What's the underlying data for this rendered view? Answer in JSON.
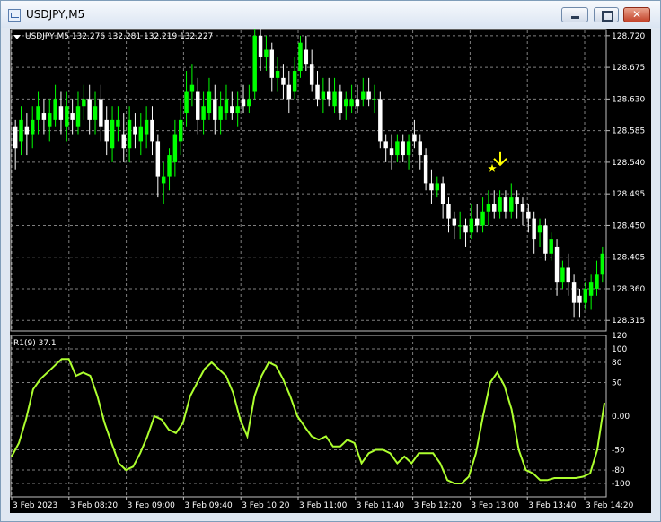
{
  "window": {
    "title": "USDJPY,M5",
    "icon": "chart-window-icon",
    "buttons": {
      "minimize": "minimize-icon",
      "maximize": "maximize-icon",
      "close": "close-icon",
      "close_glyph": "✕"
    }
  },
  "chart": {
    "symbol_line": "USDJPY,M5  132.276 132.281 132.219 132.227",
    "symbol_menu_icon": "triangle-down-icon",
    "indicator_label": "R1(9) 37.1",
    "colors": {
      "background": "#000000",
      "bull": "#00ff00",
      "bear": "#ffffff",
      "oscillator": "#adff2f",
      "grid": "#7f7f7f",
      "signal": "#ffff00"
    },
    "price_axis": [
      "128.720",
      "128.675",
      "128.630",
      "128.585",
      "128.540",
      "128.495",
      "128.450",
      "128.405",
      "128.360",
      "128.315"
    ],
    "oscillator_axis": [
      "120",
      "100",
      "80",
      "50",
      "0.00",
      "-50",
      "-80",
      "-100"
    ],
    "time_axis": [
      "3 Feb 2023",
      "3 Feb 08:20",
      "3 Feb 09:00",
      "3 Feb 09:40",
      "3 Feb 10:20",
      "3 Feb 11:00",
      "3 Feb 11:40",
      "3 Feb 12:20",
      "3 Feb 13:00",
      "3 Feb 13:40",
      "3 Feb 14:20"
    ],
    "signal_icons": [
      "sell-arrow-icon",
      "star-icon"
    ]
  },
  "chart_data": {
    "type": "candlestick",
    "price_range": [
      128.3,
      128.73
    ],
    "candles": [
      [
        128.59,
        128.56,
        128.6,
        128.53
      ],
      [
        128.57,
        128.6,
        128.62,
        128.55
      ],
      [
        128.59,
        128.58,
        128.61,
        128.55
      ],
      [
        128.58,
        128.6,
        128.62,
        128.56
      ],
      [
        128.6,
        128.62,
        128.64,
        128.58
      ],
      [
        128.61,
        128.6,
        128.63,
        128.58
      ],
      [
        128.59,
        128.61,
        128.63,
        128.57
      ],
      [
        128.6,
        128.63,
        128.65,
        128.59
      ],
      [
        128.62,
        128.6,
        128.64,
        128.58
      ],
      [
        128.59,
        128.62,
        128.64,
        128.57
      ],
      [
        128.61,
        128.6,
        128.63,
        128.58
      ],
      [
        128.59,
        128.62,
        128.64,
        128.58
      ],
      [
        128.62,
        128.63,
        128.65,
        128.6
      ],
      [
        128.63,
        128.6,
        128.65,
        128.58
      ],
      [
        128.6,
        128.62,
        128.64,
        128.58
      ],
      [
        128.63,
        128.59,
        128.65,
        128.57
      ],
      [
        128.6,
        128.57,
        128.62,
        128.55
      ],
      [
        128.56,
        128.6,
        128.62,
        128.54
      ],
      [
        128.59,
        128.6,
        128.62,
        128.57
      ],
      [
        128.58,
        128.56,
        128.61,
        128.54
      ],
      [
        128.56,
        128.6,
        128.62,
        128.54
      ],
      [
        128.59,
        128.58,
        128.61,
        128.56
      ],
      [
        128.57,
        128.59,
        128.61,
        128.55
      ],
      [
        128.58,
        128.6,
        128.62,
        128.56
      ],
      [
        128.6,
        128.57,
        128.62,
        128.55
      ],
      [
        128.57,
        128.52,
        128.58,
        128.49
      ],
      [
        128.51,
        128.52,
        128.54,
        128.48
      ],
      [
        128.52,
        128.55,
        128.56,
        128.5
      ],
      [
        128.54,
        128.58,
        128.6,
        128.52
      ],
      [
        128.57,
        128.6,
        128.63,
        128.55
      ],
      [
        128.61,
        128.64,
        128.67,
        128.59
      ],
      [
        128.64,
        128.65,
        128.68,
        128.62
      ],
      [
        128.64,
        128.6,
        128.66,
        128.58
      ],
      [
        128.6,
        128.62,
        128.64,
        128.58
      ],
      [
        128.61,
        128.64,
        128.66,
        128.6
      ],
      [
        128.63,
        128.6,
        128.65,
        128.58
      ],
      [
        128.6,
        128.62,
        128.64,
        128.58
      ],
      [
        128.61,
        128.63,
        128.65,
        128.6
      ],
      [
        128.62,
        128.61,
        128.64,
        128.6
      ],
      [
        128.61,
        128.62,
        128.64,
        128.59
      ],
      [
        128.63,
        128.62,
        128.65,
        128.61
      ],
      [
        128.62,
        128.63,
        128.65,
        128.61
      ],
      [
        128.64,
        128.72,
        128.73,
        128.63
      ],
      [
        128.72,
        128.69,
        128.73,
        128.67
      ],
      [
        128.69,
        128.7,
        128.72,
        128.67
      ],
      [
        128.7,
        128.66,
        128.71,
        128.64
      ],
      [
        128.66,
        128.67,
        128.69,
        128.64
      ],
      [
        128.66,
        128.65,
        128.68,
        128.63
      ],
      [
        128.65,
        128.63,
        128.67,
        128.61
      ],
      [
        128.64,
        128.67,
        128.69,
        128.63
      ],
      [
        128.67,
        128.71,
        128.72,
        128.66
      ],
      [
        128.7,
        128.68,
        128.72,
        128.67
      ],
      [
        128.68,
        128.65,
        128.7,
        128.64
      ],
      [
        128.65,
        128.63,
        128.67,
        128.62
      ],
      [
        128.63,
        128.64,
        128.66,
        128.61
      ],
      [
        128.64,
        128.63,
        128.66,
        128.62
      ],
      [
        128.62,
        128.64,
        128.66,
        128.61
      ],
      [
        128.64,
        128.61,
        128.65,
        128.6
      ],
      [
        128.62,
        128.63,
        128.64,
        128.6
      ],
      [
        128.62,
        128.63,
        128.65,
        128.61
      ],
      [
        128.63,
        128.62,
        128.65,
        128.61
      ],
      [
        128.63,
        128.64,
        128.66,
        128.62
      ],
      [
        128.64,
        128.63,
        128.66,
        128.62
      ],
      [
        128.63,
        128.63,
        128.65,
        128.61
      ],
      [
        128.63,
        128.57,
        128.64,
        128.56
      ],
      [
        128.57,
        128.56,
        128.58,
        128.54
      ],
      [
        128.56,
        128.55,
        128.58,
        128.53
      ],
      [
        128.55,
        128.57,
        128.58,
        128.54
      ],
      [
        128.57,
        128.55,
        128.58,
        128.54
      ],
      [
        128.55,
        128.57,
        128.58,
        128.53
      ],
      [
        128.58,
        128.57,
        128.6,
        128.56
      ],
      [
        128.57,
        128.55,
        128.58,
        128.53
      ],
      [
        128.55,
        128.51,
        128.56,
        128.5
      ],
      [
        128.51,
        128.5,
        128.53,
        128.48
      ],
      [
        128.5,
        128.51,
        128.52,
        128.49
      ],
      [
        128.51,
        128.48,
        128.52,
        128.46
      ],
      [
        128.48,
        128.46,
        128.49,
        128.44
      ],
      [
        128.46,
        128.45,
        128.47,
        128.43
      ],
      [
        128.45,
        128.45,
        128.47,
        128.43
      ],
      [
        128.45,
        128.44,
        128.46,
        128.42
      ],
      [
        128.44,
        128.46,
        128.48,
        128.43
      ],
      [
        128.46,
        128.45,
        128.48,
        128.44
      ],
      [
        128.45,
        128.47,
        128.49,
        128.44
      ],
      [
        128.47,
        128.48,
        128.5,
        128.45
      ],
      [
        128.48,
        128.47,
        128.5,
        128.46
      ],
      [
        128.47,
        128.49,
        128.5,
        128.46
      ],
      [
        128.49,
        128.47,
        128.5,
        128.46
      ],
      [
        128.47,
        128.49,
        128.51,
        128.46
      ],
      [
        128.49,
        128.48,
        128.5,
        128.46
      ],
      [
        128.48,
        128.47,
        128.49,
        128.45
      ],
      [
        128.47,
        128.46,
        128.48,
        128.44
      ],
      [
        128.46,
        128.43,
        128.47,
        128.41
      ],
      [
        128.44,
        128.45,
        128.46,
        128.42
      ],
      [
        128.45,
        128.41,
        128.46,
        128.4
      ],
      [
        128.41,
        128.43,
        128.44,
        128.4
      ],
      [
        128.42,
        128.37,
        128.43,
        128.35
      ],
      [
        128.37,
        128.39,
        128.4,
        128.36
      ],
      [
        128.39,
        128.37,
        128.41,
        128.35
      ],
      [
        128.37,
        128.34,
        128.38,
        128.32
      ],
      [
        128.35,
        128.34,
        128.36,
        128.32
      ],
      [
        128.34,
        128.36,
        128.37,
        128.33
      ],
      [
        128.35,
        128.37,
        128.38,
        128.33
      ],
      [
        128.36,
        128.38,
        128.4,
        128.35
      ],
      [
        128.38,
        128.41,
        128.42,
        128.37
      ]
    ],
    "oscillator": {
      "name": "R1(9)",
      "range": [
        -120,
        120
      ],
      "values": [
        -60,
        -40,
        -5,
        40,
        55,
        65,
        75,
        85,
        85,
        60,
        65,
        60,
        30,
        -10,
        -40,
        -70,
        -80,
        -75,
        -55,
        -30,
        0,
        -5,
        -20,
        -25,
        -10,
        30,
        50,
        70,
        80,
        70,
        60,
        35,
        -5,
        -30,
        30,
        60,
        80,
        75,
        55,
        30,
        0,
        -15,
        -30,
        -35,
        -30,
        -45,
        -45,
        -35,
        -40,
        -70,
        -55,
        -50,
        -50,
        -55,
        -70,
        -60,
        -70,
        -55,
        -55,
        -55,
        -70,
        -95,
        -100,
        -100,
        -90,
        -55,
        0,
        50,
        65,
        45,
        10,
        -50,
        -80,
        -85,
        -95,
        -95,
        -92,
        -92,
        -92,
        -92,
        -90,
        -85,
        -50,
        20
      ]
    },
    "signal": {
      "type": "sell",
      "price": 128.535
    }
  }
}
